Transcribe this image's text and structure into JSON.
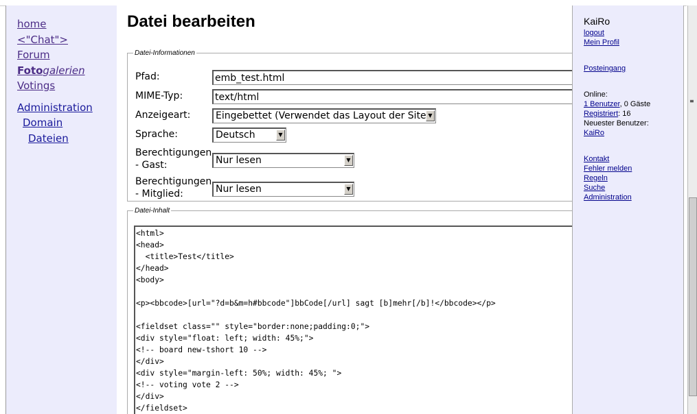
{
  "nav": {
    "home": "home",
    "chat": "<\"Chat\">",
    "forum": "Forum",
    "foto_bold": "Foto",
    "foto_italic": "galerien",
    "votings": "Votings",
    "administration": "Administration",
    "domain": "Domain",
    "dateien": "Dateien"
  },
  "page_title": "Datei bearbeiten",
  "info": {
    "legend": "Datei-Informationen",
    "pfad_label": "Pfad:",
    "pfad_value": "emb_test.html",
    "mime_label": "MIME-Typ:",
    "mime_value": "text/html",
    "anzeige_label": "Anzeigeart:",
    "anzeige_value": "Eingebettet (Verwendet das Layout der Site)",
    "sprache_label": "Sprache:",
    "sprache_value": "Deutsch",
    "gast_label_1": "Berechtigungen",
    "gast_label_2": "- Gast:",
    "gast_value": "Nur lesen",
    "mitglied_label_1": "Berechtigungen",
    "mitglied_label_2": "- Mitglied:",
    "mitglied_value": "Nur lesen"
  },
  "content": {
    "legend": "Datei-Inhalt",
    "lines": [
      "<html>",
      "<head>",
      "  <title>Test</title>",
      "</head>",
      "<body>",
      "",
      "<p><bbcode>[url=\"?d=b&m=h#bbcode\"]bbCode[/url] sagt [b]mehr[/b]!</bbcode></p>",
      "",
      "<fieldset class=\"\" style=\"border:none;padding:0;\">",
      "<div style=\"float: left; width: 45%;\">",
      "<!-- board new-tshort 10 -->",
      "</div>",
      "<div style=\"margin-left: 50%; width: 45%; \">",
      "<!-- voting vote 2 -->",
      "</div>",
      "</fieldset>"
    ]
  },
  "sidebar": {
    "user": "KaiRo",
    "logout": "logout",
    "mein_profil": "Mein Profil",
    "posteingang": "Posteingang",
    "online_label": "Online:",
    "benutzer_link": "1 Benutzer",
    "gaeste": ", 0 Gäste",
    "registriert_link": "Registriert",
    "registriert_count": ": 16",
    "neuester_label": "Neuester Benutzer:",
    "neuester_user": "KaiRo",
    "kontakt": "Kontakt",
    "fehler_melden": "Fehler melden",
    "regeln": "Regeln",
    "suche": "Suche",
    "administration": "Administration"
  }
}
